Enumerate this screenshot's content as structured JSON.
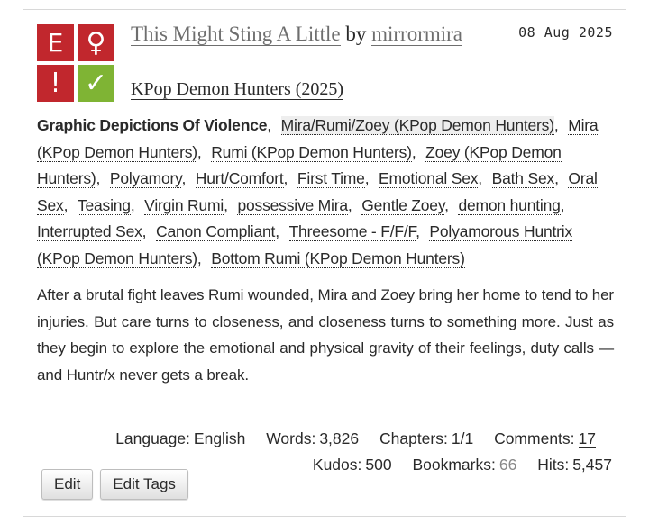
{
  "work": {
    "title": "This Might Sting A Little",
    "by_word": "by",
    "author": "mirrormira",
    "fandom": "KPop Demon Hunters (2025)",
    "date": "08 Aug 2025"
  },
  "required_tags": [
    {
      "glyph": "E",
      "name": "explicit-rating",
      "color": "#c1272d"
    },
    {
      "glyph": "♀",
      "name": "ff-category",
      "color": "#c1272d"
    },
    {
      "glyph": "!",
      "name": "warnings",
      "color": "#c1272d"
    },
    {
      "glyph": "✓",
      "name": "complete-status",
      "color": "#7fb434"
    }
  ],
  "tags": [
    {
      "text": "Graphic Depictions Of Violence",
      "type": "warning"
    },
    {
      "text": "Mira/Rumi/Zoey (KPop Demon Hunters)",
      "type": "relationship"
    },
    {
      "text": "Mira (KPop Demon Hunters)",
      "type": "character"
    },
    {
      "text": "Rumi (KPop Demon Hunters)",
      "type": "character"
    },
    {
      "text": "Zoey (KPop Demon Hunters)",
      "type": "character"
    },
    {
      "text": "Polyamory",
      "type": "freeform"
    },
    {
      "text": "Hurt/Comfort",
      "type": "freeform"
    },
    {
      "text": "First Time",
      "type": "freeform"
    },
    {
      "text": "Emotional Sex",
      "type": "freeform"
    },
    {
      "text": "Bath Sex",
      "type": "freeform"
    },
    {
      "text": "Oral Sex",
      "type": "freeform"
    },
    {
      "text": "Teasing",
      "type": "freeform"
    },
    {
      "text": "Virgin Rumi",
      "type": "freeform"
    },
    {
      "text": "possessive Mira",
      "type": "freeform"
    },
    {
      "text": "Gentle Zoey",
      "type": "freeform"
    },
    {
      "text": "demon hunting",
      "type": "freeform"
    },
    {
      "text": "Interrupted Sex",
      "type": "freeform"
    },
    {
      "text": "Canon Compliant",
      "type": "freeform"
    },
    {
      "text": "Threesome - F/F/F",
      "type": "freeform"
    },
    {
      "text": "Polyamorous Huntrix (KPop Demon Hunters)",
      "type": "freeform"
    },
    {
      "text": "Bottom Rumi (KPop Demon Hunters)",
      "type": "freeform"
    }
  ],
  "summary": "After a brutal fight leaves Rumi wounded, Mira and Zoey bring her home to tend to her injuries. But care turns to closeness, and closeness turns to something more. Just as they begin to explore the emotional and physical gravity of their feelings, duty calls — and Huntr/x never gets a break.",
  "stats": {
    "language_label": "Language:",
    "language": "English",
    "words_label": "Words:",
    "words": "3,826",
    "chapters_label": "Chapters:",
    "chapters": "1/1",
    "comments_label": "Comments:",
    "comments": "17",
    "kudos_label": "Kudos:",
    "kudos": "500",
    "bookmarks_label": "Bookmarks:",
    "bookmarks": "66",
    "hits_label": "Hits:",
    "hits": "5,457"
  },
  "actions": {
    "edit_label": "Edit",
    "edit_tags_label": "Edit Tags"
  }
}
